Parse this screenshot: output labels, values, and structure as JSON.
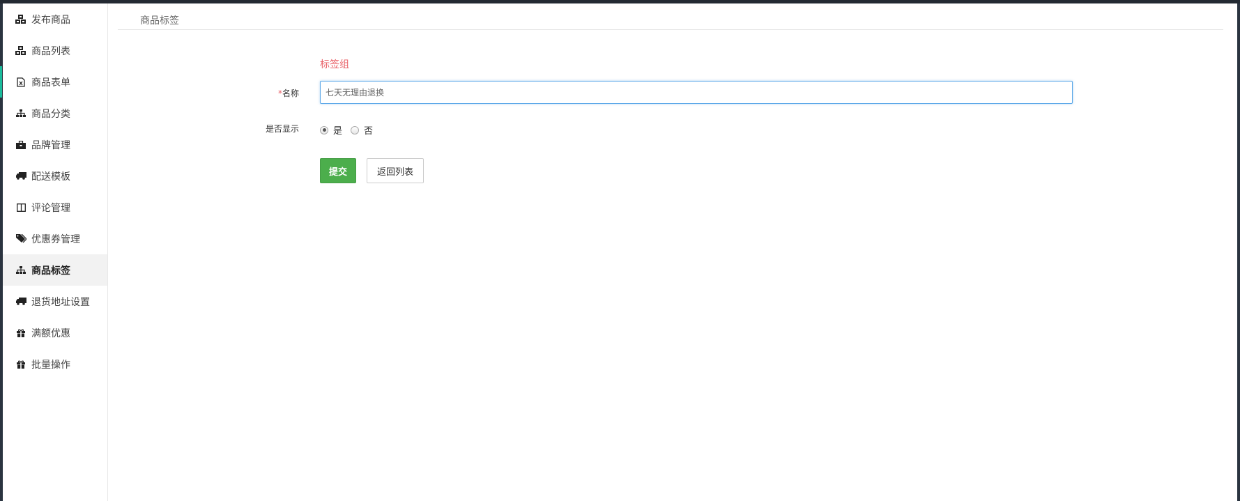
{
  "sidebar": {
    "items": [
      {
        "label": "发布商品",
        "icon": "cubes-icon"
      },
      {
        "label": "商品列表",
        "icon": "cubes-icon"
      },
      {
        "label": "商品表单",
        "icon": "file-excel-icon"
      },
      {
        "label": "商品分类",
        "icon": "sitemap-icon"
      },
      {
        "label": "品牌管理",
        "icon": "briefcase-icon"
      },
      {
        "label": "配送模板",
        "icon": "truck-icon"
      },
      {
        "label": "评论管理",
        "icon": "columns-icon"
      },
      {
        "label": "优惠券管理",
        "icon": "tags-icon"
      },
      {
        "label": "商品标签",
        "icon": "sitemap-icon",
        "active": true
      },
      {
        "label": "退货地址设置",
        "icon": "truck-icon"
      },
      {
        "label": "满额优惠",
        "icon": "gift-icon"
      },
      {
        "label": "批量操作",
        "icon": "gift-icon"
      }
    ]
  },
  "breadcrumb": {
    "title": "商品标签"
  },
  "form": {
    "group_title": "标签组",
    "name_required_mark": "*",
    "name_label": "名称",
    "name_value": "七天无理由退换",
    "show_label": "是否显示",
    "show_options": [
      {
        "label": "是",
        "checked": true
      },
      {
        "label": "否",
        "checked": false
      }
    ],
    "submit_label": "提交",
    "back_label": "返回列表"
  },
  "colors": {
    "accent_red": "#e9636a",
    "submit_green": "#4cae4c",
    "input_focus_blue": "#5ba7e8",
    "frame_dark": "#232a33"
  }
}
